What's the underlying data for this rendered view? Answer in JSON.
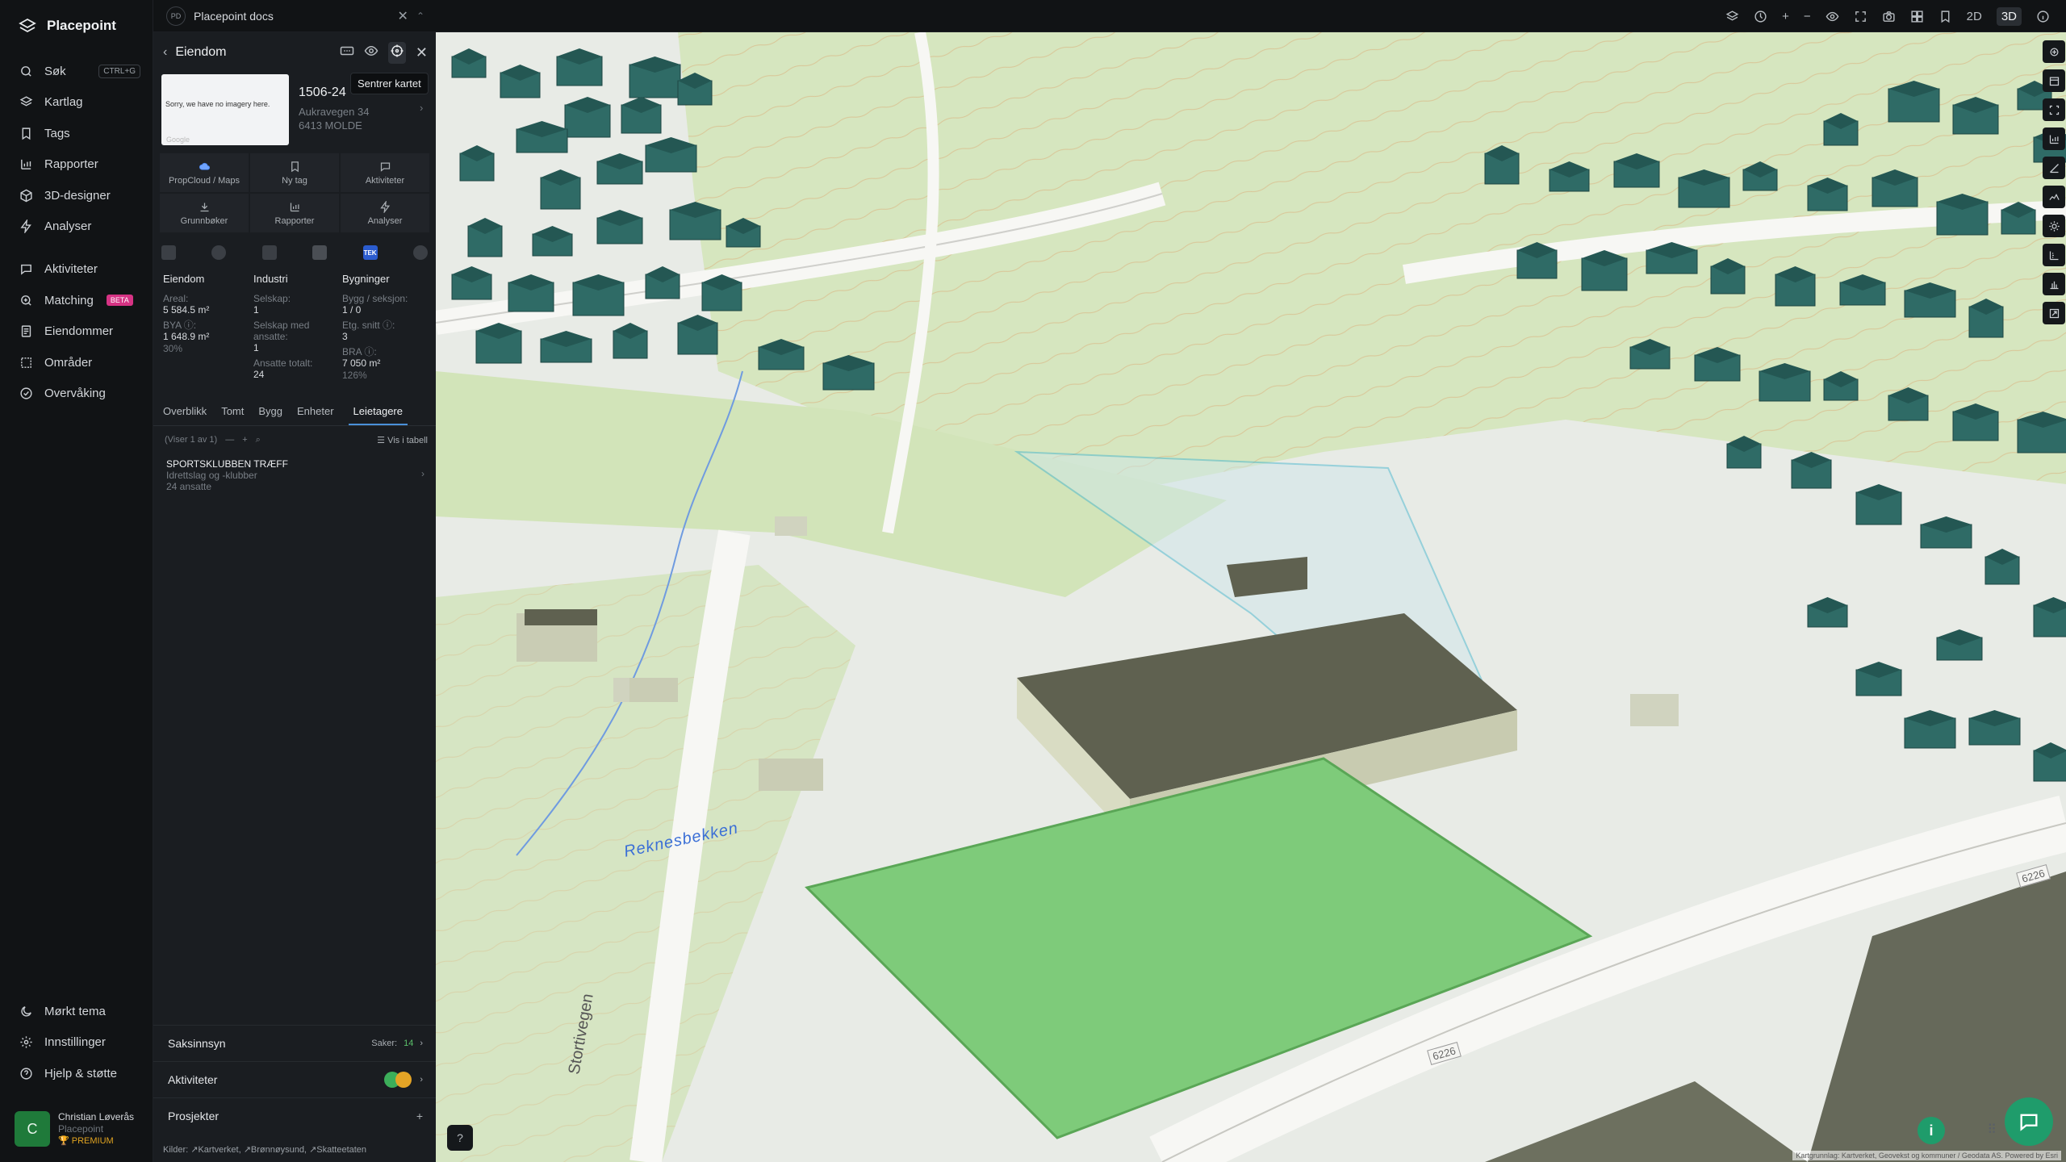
{
  "app": {
    "name": "Placepoint"
  },
  "nav": {
    "items": [
      {
        "label": "Søk",
        "kbd": "CTRL+G"
      },
      {
        "label": "Kartlag"
      },
      {
        "label": "Tags"
      },
      {
        "label": "Rapporter"
      },
      {
        "label": "3D-designer"
      },
      {
        "label": "Analyser"
      },
      {
        "label": "Aktiviteter"
      },
      {
        "label": "Matching",
        "badge": "BETA"
      },
      {
        "label": "Eiendommer"
      },
      {
        "label": "Områder"
      },
      {
        "label": "Overvåking"
      }
    ],
    "bottom": [
      {
        "label": "Mørkt tema"
      },
      {
        "label": "Innstillinger"
      },
      {
        "label": "Hjelp & støtte"
      }
    ],
    "user": {
      "initial": "C",
      "name": "Christian Løverås",
      "org": "Placepoint",
      "plan": "PREMIUM"
    }
  },
  "topbar": {
    "doc_badge": "PD",
    "doc_title": "Placepoint docs",
    "view_2d": "2D",
    "view_3d": "3D"
  },
  "panel": {
    "title": "Eiendom",
    "tooltip": "Sentrer kartet",
    "thumb_text": "Sorry, we have no imagery here.",
    "thumb_google": "Google",
    "prop_id": "1506-24",
    "address_line1": "Aukravegen 34",
    "address_line2": "6413 MOLDE",
    "quick": [
      {
        "label": "PropCloud / Maps",
        "icon": "cloud-icon"
      },
      {
        "label": "Ny tag",
        "icon": "bookmark-icon"
      },
      {
        "label": "Aktiviteter",
        "icon": "chat-icon"
      },
      {
        "label": "Grunnbøker",
        "icon": "download-icon"
      },
      {
        "label": "Rapporter",
        "icon": "bar-chart-icon"
      },
      {
        "label": "Analyser",
        "icon": "bolt-icon"
      }
    ],
    "source_tek": "TEK",
    "eiendom": {
      "heading": "Eiendom",
      "areal_label": "Areal:",
      "areal": "5 584.5 m²",
      "bya_label": "BYA ⓘ:",
      "bya": "1 648.9 m²",
      "bya_pct": "30%"
    },
    "industri": {
      "heading": "Industri",
      "selskap_label": "Selskap:",
      "selskap": "1",
      "ansatte_label": "Selskap med ansatte:",
      "ansatte": "1",
      "tot_label": "Ansatte totalt:",
      "tot": "24"
    },
    "bygninger": {
      "heading": "Bygninger",
      "bygg_label": "Bygg / seksjon:",
      "bygg": "1 / 0",
      "etg_label": "Etg. snitt ⓘ:",
      "etg": "3",
      "bra_label": "BRA ⓘ:",
      "bra": "7 050 m²",
      "bra_pct": "126%"
    },
    "tabs": [
      "Overblikk",
      "Tomt",
      "Bygg",
      "Enheter",
      "Leietagere"
    ],
    "list_count": "(Viser 1 av 1)",
    "list_table": "Vis i tabell",
    "result": {
      "name": "SPORTSKLUBBEN TRÆFF",
      "type": "Idrettslag og -klubber",
      "employees": "24 ansatte"
    },
    "sections": {
      "saksinnsyn": "Saksinnsyn",
      "saker_label": "Saker:",
      "saker": "14",
      "aktiviteter": "Aktiviteter",
      "prosjekter": "Prosjekter"
    },
    "sources": "Kilder: ↗Kartverket, ↗Brønnøysund, ↗Skatteetaten"
  },
  "map": {
    "stream_label": "Reknesbekken",
    "road_label": "Stortivegen",
    "road_shield_1": "6226",
    "road_shield_2": "6226",
    "attribution": "Kartgrunnlag: Kartverket, Geovekst og kommuner / Geodata AS. Powered by Esri",
    "colors": {
      "building": "#2f6b66",
      "field": "#7ecb7a",
      "large_building": "#5f6150",
      "terrain": "#e9ece7",
      "green": "#cfe2b4"
    }
  }
}
